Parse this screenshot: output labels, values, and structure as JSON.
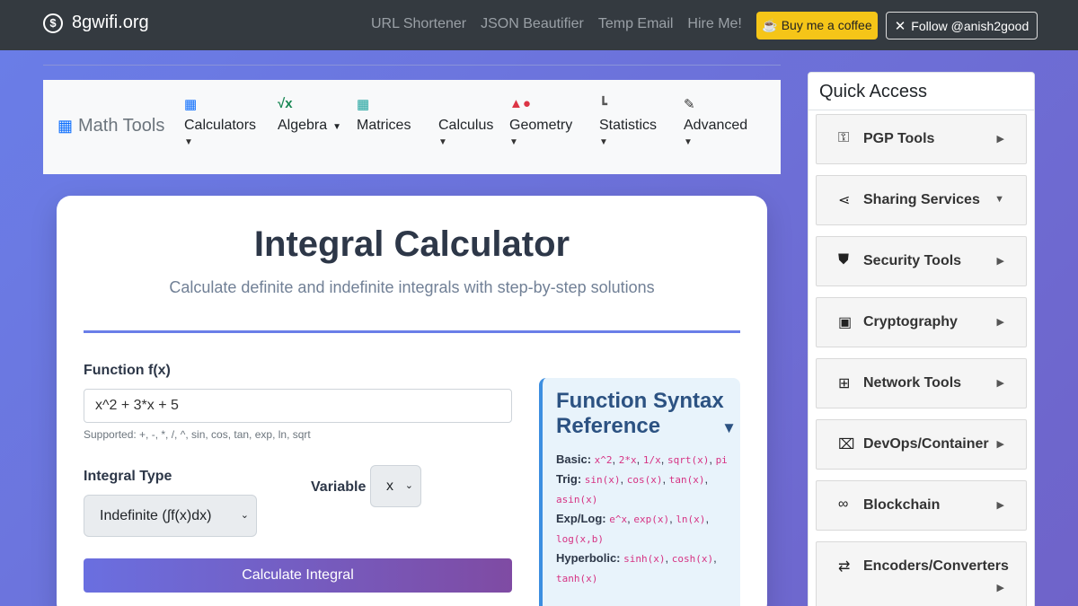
{
  "topbar": {
    "brand": "8gwifi.org",
    "links": [
      "URL Shortener",
      "JSON Beautifier",
      "Temp Email",
      "Hire Me!"
    ],
    "coffee_button": "☕ Buy me a coffee",
    "follow_button": "Follow @anish2good"
  },
  "mathnav": {
    "title": "Math Tools",
    "items": [
      "Calculators",
      "Algebra",
      "Matrices",
      "Calculus",
      "Geometry",
      "Statistics",
      "Advanced"
    ]
  },
  "main": {
    "title": "Integral Calculator",
    "subtitle": "Calculate definite and indefinite integrals with step-by-step solutions",
    "function_label": "Function f(x)",
    "function_value": "x^2 + 3*x + 5",
    "function_help": "Supported: +, -, *, /, ^, sin, cos, tan, exp, ln, sqrt",
    "integral_type_label": "Integral Type",
    "integral_type_value": "Indefinite (∫f(x)dx)",
    "variable_label": "Variable",
    "variable_value": "x",
    "calculate_button": "Calculate Integral"
  },
  "reference": {
    "title": "Function Syntax Reference",
    "rows": [
      {
        "label": "Basic:",
        "codes": [
          "x^2",
          "2*x",
          "1/x",
          "sqrt(x)",
          "pi"
        ]
      },
      {
        "label": "Trig:",
        "codes": [
          "sin(x)",
          "cos(x)",
          "tan(x)",
          "asin(x)"
        ]
      },
      {
        "label": "Exp/Log:",
        "codes": [
          "e^x",
          "exp(x)",
          "ln(x)",
          "log(x,b)"
        ]
      },
      {
        "label": "Hyperbolic:",
        "codes": [
          "sinh(x)",
          "cosh(x)",
          "tanh(x)"
        ]
      }
    ]
  },
  "quick_access": {
    "title": "Quick Access",
    "items": [
      {
        "label": "PGP Tools",
        "icon": "key-icon",
        "arrow": "▶"
      },
      {
        "label": "Sharing Services",
        "icon": "share-icon",
        "arrow": "▼"
      },
      {
        "label": "Security Tools",
        "icon": "shield-icon",
        "arrow": "▶"
      },
      {
        "label": "Cryptography",
        "icon": "lock-icon",
        "arrow": "▶"
      },
      {
        "label": "Network Tools",
        "icon": "network-icon",
        "arrow": "▶"
      },
      {
        "label": "DevOps/Container",
        "icon": "docker-icon",
        "arrow": "▶"
      },
      {
        "label": "Blockchain",
        "icon": "link-icon",
        "arrow": "▶"
      },
      {
        "label": "Encoders/Converters",
        "icon": "exchange-icon",
        "arrow": "▶"
      }
    ]
  },
  "colors": {
    "accent": "#6a7ee8",
    "coffee": "#f5c518",
    "code": "#d63384"
  }
}
